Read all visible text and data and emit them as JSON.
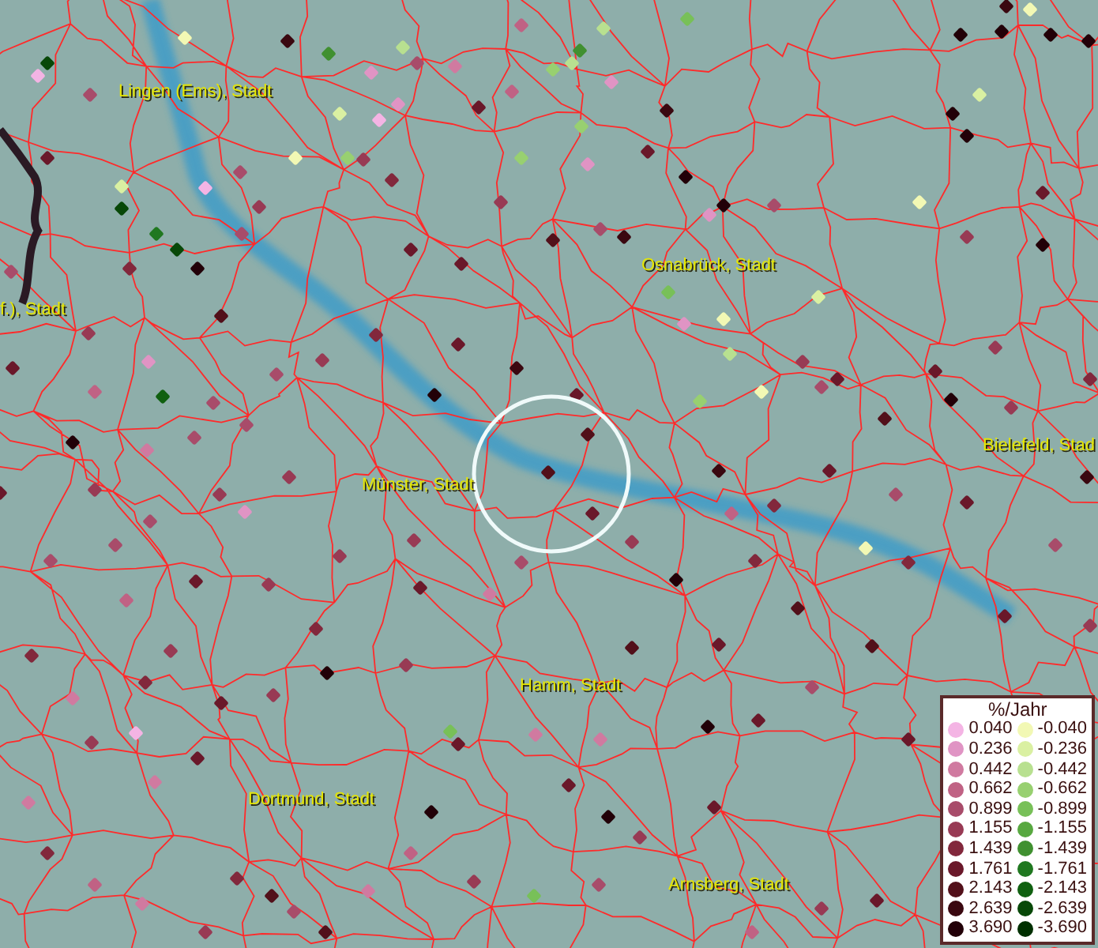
{
  "map": {
    "cities": [
      {
        "label": "Lingen (Ems), Stadt"
      },
      {
        "label": "Osnabrück, Stadt"
      },
      {
        "label": "f.), Stadt"
      },
      {
        "label": "Münster, Stadt"
      },
      {
        "label": "Bielefeld, Stad"
      },
      {
        "label": "Hamm, Stadt"
      },
      {
        "label": "Dortmund, Stadt"
      },
      {
        "label": "Arnsberg, Stadt"
      }
    ]
  },
  "legend": {
    "title": "%/Jahr",
    "positive": [
      {
        "value": "0.040",
        "color": "#f4b4e4"
      },
      {
        "value": "0.236",
        "color": "#e094c4"
      },
      {
        "value": "0.442",
        "color": "#d07aa0"
      },
      {
        "value": "0.662",
        "color": "#c06284"
      },
      {
        "value": "0.899",
        "color": "#a84c6a"
      },
      {
        "value": "1.155",
        "color": "#983a54"
      },
      {
        "value": "1.439",
        "color": "#82283c"
      },
      {
        "value": "1.761",
        "color": "#6a182a"
      },
      {
        "value": "2.143",
        "color": "#52101a"
      },
      {
        "value": "2.639",
        "color": "#3a0810"
      },
      {
        "value": "3.690",
        "color": "#220008"
      }
    ],
    "negative": [
      {
        "value": "-0.040",
        "color": "#f2f8b4"
      },
      {
        "value": "-0.236",
        "color": "#daf0a2"
      },
      {
        "value": "-0.442",
        "color": "#b8e090"
      },
      {
        "value": "-0.662",
        "color": "#98d070"
      },
      {
        "value": "-0.899",
        "color": "#78c058"
      },
      {
        "value": "-1.155",
        "color": "#58a840"
      },
      {
        "value": "-1.439",
        "color": "#409030"
      },
      {
        "value": "-1.761",
        "color": "#207820"
      },
      {
        "value": "-2.143",
        "color": "#106010"
      },
      {
        "value": "-2.639",
        "color": "#084808"
      },
      {
        "value": "-3.690",
        "color": "#003000"
      }
    ]
  }
}
